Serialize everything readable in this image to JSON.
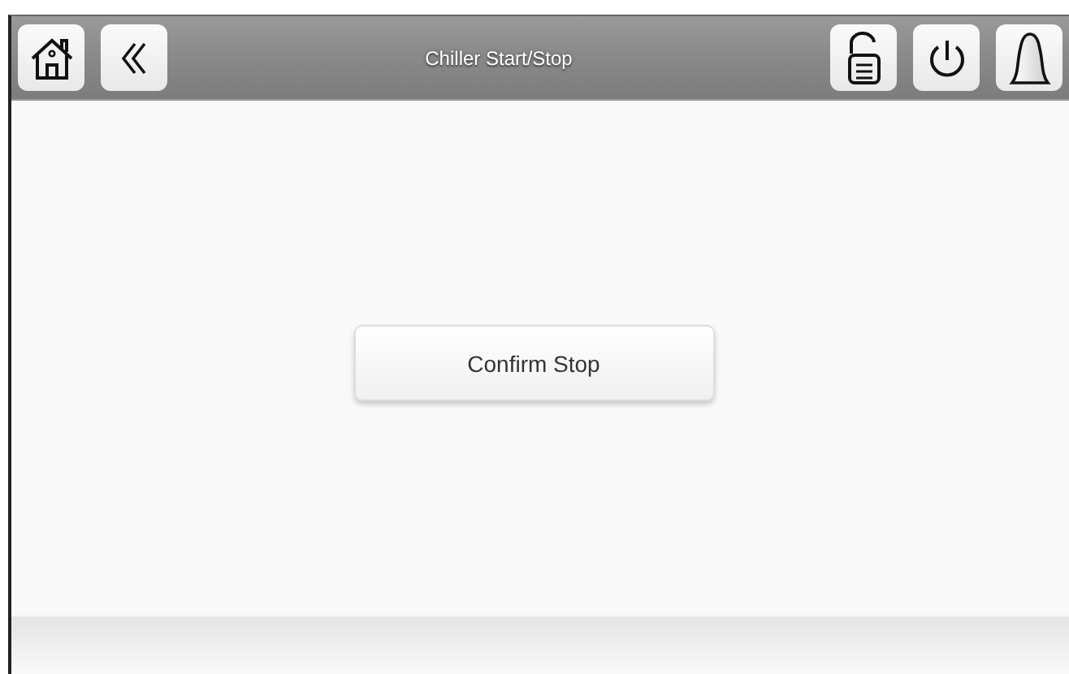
{
  "header": {
    "title": "Chiller Start/Stop"
  },
  "action_button": {
    "label": "Confirm Stop"
  }
}
